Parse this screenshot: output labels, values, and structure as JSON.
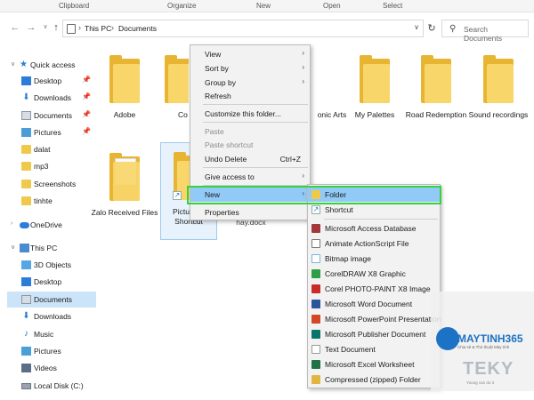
{
  "ribbon": {
    "groups": [
      "Clipboard",
      "Organize",
      "New",
      "Open",
      "Select"
    ]
  },
  "nav": {
    "back_icon": "back-arrow-icon",
    "forward_icon": "forward-arrow-icon",
    "recent_icon": "chevron-down-icon",
    "up_icon": "up-arrow-icon"
  },
  "address": {
    "segments": [
      "This PC",
      "Documents"
    ]
  },
  "search": {
    "placeholder": "Search Documents"
  },
  "sidebar": {
    "quick_access": "Quick access",
    "items": [
      {
        "label": "Desktop",
        "pinned": true
      },
      {
        "label": "Downloads",
        "pinned": true
      },
      {
        "label": "Documents",
        "pinned": true
      },
      {
        "label": "Pictures",
        "pinned": true
      },
      {
        "label": "dalat",
        "pinned": false
      },
      {
        "label": "mp3",
        "pinned": false
      },
      {
        "label": "Screenshots",
        "pinned": false
      },
      {
        "label": "tinhte",
        "pinned": false
      }
    ],
    "onedrive": "OneDrive",
    "this_pc": "This PC",
    "pc_items": [
      "3D Objects",
      "Desktop",
      "Documents",
      "Downloads",
      "Music",
      "Pictures",
      "Videos",
      "Local Disk (C:)"
    ]
  },
  "files": {
    "row1": [
      "Adobe",
      "Co",
      "onic Arts",
      "My Palettes",
      "Road Redemption",
      "Sound recordings"
    ],
    "row2": [
      "Zalo Received Files",
      "Pictures - Shortcut",
      "va sao hay.docx"
    ]
  },
  "context_menu": {
    "items": [
      {
        "label": "View",
        "arrow": true
      },
      {
        "label": "Sort by",
        "arrow": true
      },
      {
        "label": "Group by",
        "arrow": true
      },
      {
        "label": "Refresh"
      },
      {
        "label": "Customize this folder..."
      },
      {
        "label": "Paste",
        "disabled": true
      },
      {
        "label": "Paste shortcut",
        "disabled": true
      },
      {
        "label": "Undo Delete",
        "shortcut": "Ctrl+Z"
      },
      {
        "label": "Give access to",
        "arrow": true
      },
      {
        "label": "New",
        "arrow": true,
        "highlighted": true
      },
      {
        "label": "Properties"
      }
    ]
  },
  "new_submenu": {
    "items": [
      {
        "label": "Folder",
        "icon": "folder-icon",
        "color": "#f0c94a",
        "highlighted": true
      },
      {
        "label": "Shortcut",
        "icon": "shortcut-icon",
        "color": "#1c72c4"
      },
      {
        "label": "Microsoft Access Database",
        "icon": "access-icon",
        "color": "#a4373a"
      },
      {
        "label": "Animate ActionScript File",
        "icon": "animate-icon",
        "color": "#555555"
      },
      {
        "label": "Bitmap image",
        "icon": "bitmap-icon",
        "color": "#7ab3de"
      },
      {
        "label": "CorelDRAW X8 Graphic",
        "icon": "coreldraw-icon",
        "color": "#2f9e44"
      },
      {
        "label": "Corel PHOTO-PAINT X8 Image",
        "icon": "photopaint-icon",
        "color": "#c92a2a"
      },
      {
        "label": "Microsoft Word Document",
        "icon": "word-icon",
        "color": "#2b579a"
      },
      {
        "label": "Microsoft PowerPoint Presentation",
        "icon": "powerpoint-icon",
        "color": "#d24726"
      },
      {
        "label": "Microsoft Publisher Document",
        "icon": "publisher-icon",
        "color": "#077568"
      },
      {
        "label": "Text Document",
        "icon": "text-icon",
        "color": "#e6e6e6"
      },
      {
        "label": "Microsoft Excel Worksheet",
        "icon": "excel-icon",
        "color": "#217346"
      },
      {
        "label": "Compressed (zipped) Folder",
        "icon": "zip-icon",
        "color": "#e0b640"
      }
    ]
  },
  "watermark": {
    "brand": "MAYTINH365",
    "tagline": "Chia sẻ & Thủ thuật Máy tính",
    "brand2": "TEKY",
    "tagline2": "Young can do it"
  },
  "colors": {
    "highlight": "#91c9f7",
    "selected_nav": "#cce4f7",
    "green_outline": "#39d13c",
    "folder": "#f0c94a"
  }
}
